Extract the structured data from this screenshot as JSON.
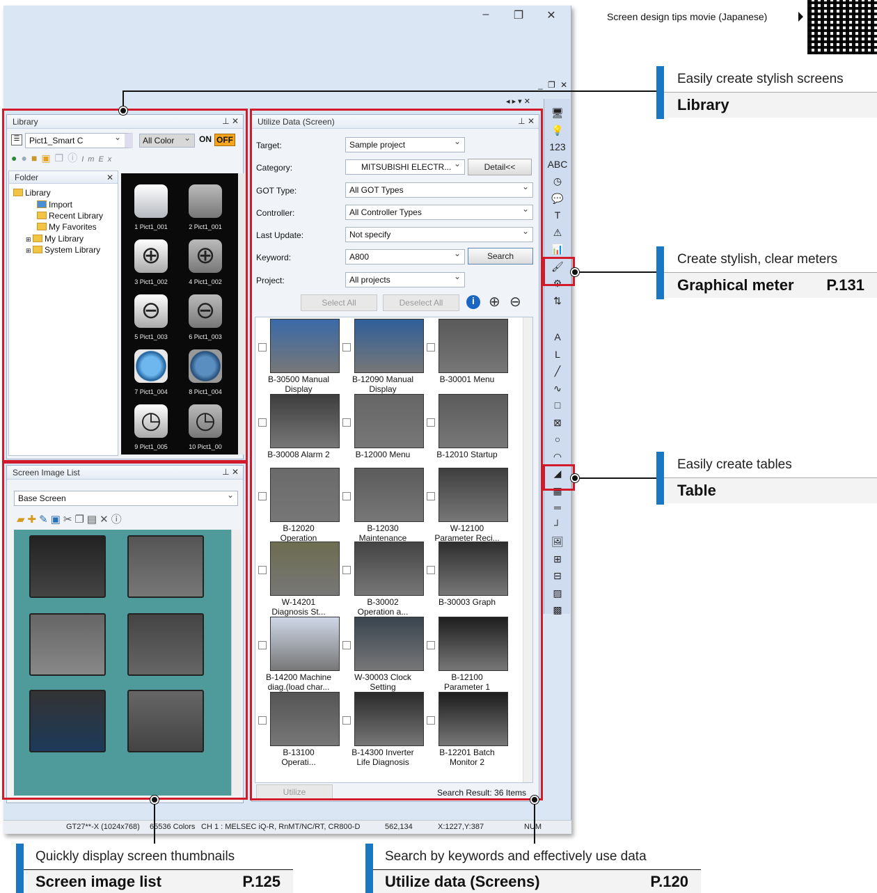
{
  "qr_caption": "Screen design tips movie (Japanese)",
  "window": {
    "min": "–",
    "restore": "❐",
    "close": "✕",
    "doc_controls": "_ ❐ ✕",
    "mini_controls": "◂ ▸ ▾ ✕"
  },
  "library": {
    "title": "Library",
    "pin": "⊥ ✕",
    "combo": "Pict1_Smart C",
    "color_combo": "All Color",
    "on": "ON",
    "off": "OFF",
    "folder_title": "Folder",
    "tree": [
      "Library",
      "Import",
      "Recent Library",
      "My Favorites",
      "My Library",
      "System Library"
    ],
    "items": [
      "1 Pict1_001",
      "2 Pict1_001",
      "3 Pict1_002",
      "4 Pict1_002",
      "5 Pict1_003",
      "6 Pict1_003",
      "7 Pict1_004",
      "8 Pict1_004",
      "9 Pict1_005",
      "10 Pict1_00"
    ],
    "glyphs": [
      "",
      "",
      "⊕",
      "⊕",
      "⊖",
      "⊖",
      "◉",
      "◉",
      "◷",
      "◷"
    ]
  },
  "screen_image_list": {
    "title": "Screen Image List",
    "pin": "⊥ ✕",
    "combo": "Base Screen"
  },
  "utilize": {
    "title": "Utilize Data (Screen)",
    "pin": "⊥ ✕",
    "labels": {
      "target": "Target:",
      "category": "Category:",
      "got": "GOT Type:",
      "controller": "Controller:",
      "update": "Last Update:",
      "keyword": "Keyword:",
      "project": "Project:"
    },
    "values": {
      "target": "Sample project",
      "category": "MITSUBISHI ELECTR...",
      "got": "All GOT Types",
      "controller": "All Controller Types",
      "update": "Not specify",
      "keyword": "A800",
      "project": "All projects"
    },
    "detail": "Detail<<",
    "search": "Search",
    "select_all": "Select All",
    "deselect_all": "Deselect All",
    "utilize_btn": "Utilize",
    "result": "Search Result: 36 Items",
    "tiles": [
      "B-30500 Manual\nDisplay",
      "B-12090 Manual\nDisplay",
      "B-30001 Menu",
      "B-30008 Alarm 2",
      "B-12000 Menu",
      "B-12010 Startup",
      "B-12020\nOperation",
      "B-12030\nMaintenance",
      "W-12100\nParameter Reci...",
      "W-14201\nDiagnosis St...",
      "B-30002\nOperation a...",
      "B-30003 Graph",
      "B-14200 Machine\ndiag.(load char...",
      "W-30003 Clock\nSetting",
      "B-12100\nParameter 1",
      "B-13100\nOperati...",
      "B-14300 Inverter\nLife Diagnosis",
      "B-12201 Batch\nMonitor 2"
    ]
  },
  "status_bar": {
    "model": "GT27**-X (1024x768)",
    "colors": "65536 Colors",
    "channel": "CH 1 : MELSEC iQ-R, RnMT/NC/RT, CR800-D",
    "size": "562,134",
    "pos": "X:1227,Y:387",
    "mode": "NUM"
  },
  "right_toolbar": [
    "🖥",
    "💡",
    "123",
    "ABC",
    "◷",
    "💬",
    "T",
    "⚠",
    "📊",
    "🖌",
    "⚙",
    "⇅",
    "A",
    "L",
    "╱",
    "∿",
    "□",
    "⊠",
    "○",
    "◠",
    "◢",
    "▦",
    "═",
    "┘",
    "🖼",
    "⊞",
    "⊟",
    "▨",
    "▩"
  ],
  "callouts": {
    "library": {
      "desc": "Easily create stylish screens",
      "name": "Library",
      "page": ""
    },
    "meter": {
      "desc": "Create stylish, clear meters",
      "name": "Graphical meter",
      "page": "P.131"
    },
    "table": {
      "desc": "Easily create tables",
      "name": "Table",
      "page": ""
    },
    "sil": {
      "desc": "Quickly display screen thumbnails",
      "name": "Screen image list",
      "page": "P.125"
    },
    "util": {
      "desc": "Search by keywords and effectively use data",
      "name": "Utilize data (Screens)",
      "page": "P.120"
    }
  }
}
